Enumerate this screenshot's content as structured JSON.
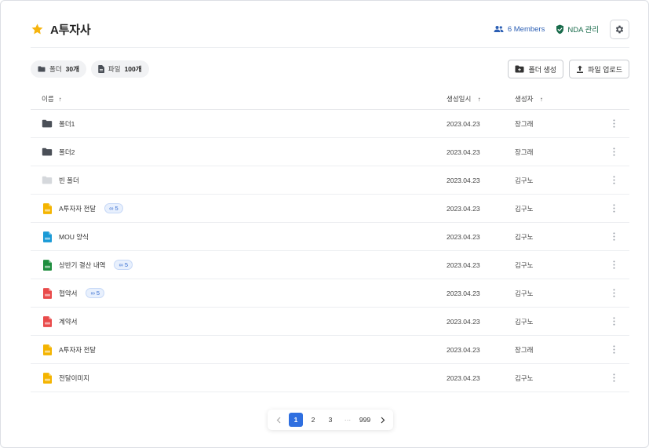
{
  "header": {
    "title": "A투자사",
    "members_label": "6 Members",
    "nda_label": "NDA 관리"
  },
  "counts": {
    "folder_prefix": "폴더",
    "folder_count": "30개",
    "file_prefix": "파일",
    "file_count": "100개"
  },
  "actions": {
    "create_folder": "폴더 생성",
    "upload_file": "파일 업로드"
  },
  "table": {
    "columns": {
      "name": "이름",
      "date": "생성일시",
      "creator": "생성자"
    },
    "rows": [
      {
        "name": "폴더1",
        "icon": "folder-icon",
        "badge": "",
        "date": "2023.04.23",
        "creator": "장그래"
      },
      {
        "name": "폴더2",
        "icon": "folder-icon",
        "badge": "",
        "date": "2023.04.23",
        "creator": "장그래"
      },
      {
        "name": "빈 폴더",
        "icon": "empty-folder-icon",
        "badge": "",
        "date": "2023.04.23",
        "creator": "김구노"
      },
      {
        "name": "A투자자 전달",
        "icon": "slides-file-icon",
        "badge": "5",
        "date": "2023.04.23",
        "creator": "김구노"
      },
      {
        "name": "MOU 양식",
        "icon": "doc-file-icon",
        "badge": "",
        "date": "2023.04.23",
        "creator": "김구노"
      },
      {
        "name": "상반기 결산 내역",
        "icon": "sheet-file-icon",
        "badge": "5",
        "date": "2023.04.23",
        "creator": "김구노"
      },
      {
        "name": "협약서",
        "icon": "pdf-file-icon",
        "badge": "5",
        "date": "2023.04.23",
        "creator": "김구노"
      },
      {
        "name": "계약서",
        "icon": "pdf-file-icon",
        "badge": "",
        "date": "2023.04.23",
        "creator": "김구노"
      },
      {
        "name": "A투자자 전달",
        "icon": "slides-file-icon",
        "badge": "",
        "date": "2023.04.23",
        "creator": "장그래"
      },
      {
        "name": "전달이미지",
        "icon": "image-file-icon",
        "badge": "",
        "date": "2023.04.23",
        "creator": "김구노"
      }
    ]
  },
  "pagination": {
    "pages": [
      "1",
      "2",
      "3",
      "···",
      "999"
    ],
    "current": "1"
  },
  "colors": {
    "accent": "#2f6fe0",
    "star": "#f6b40e",
    "folder": "#4a4f57",
    "empty_folder": "#d5d8dc",
    "slides": "#f4b400",
    "doc": "#1a9ad6",
    "sheet": "#1e8e3e",
    "pdf": "#e94b4b",
    "image": "#f4b400",
    "members": "#2c5fb4",
    "nda": "#196b4b"
  }
}
